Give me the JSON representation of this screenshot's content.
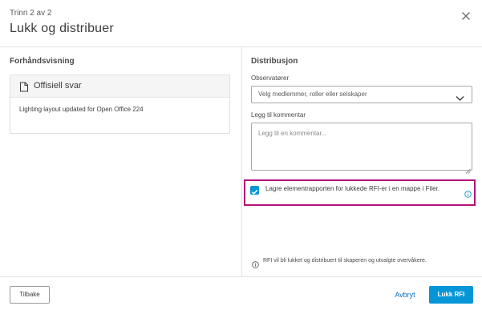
{
  "header": {
    "step": "Trinn 2 av 2",
    "title": "Lukk og distribuer",
    "close_icon": "close-icon"
  },
  "preview": {
    "section_label": "Forhåndsvisning",
    "card_icon": "document-icon",
    "card_title": "Offisiell svar",
    "card_body": "Lighting layout updated for Open Office 224"
  },
  "distribution": {
    "section_label": "Distribusjon",
    "observers_label": "Observatører",
    "observers_placeholder": "Velg medlemmer, roller eller selskaper",
    "comment_label": "Legg til kommentar",
    "comment_placeholder": "Legg til en kommentar...",
    "save_report_checked": true,
    "save_report_text": "Lagre elementrapporten for lukkede RFI-er i en mappe i Filer.",
    "note_text": "RFI vil bli lukket og distribuert til skaperen og utvalgte overvåkere."
  },
  "footer": {
    "back_label": "Tilbake",
    "cancel_label": "Avbryt",
    "primary_label": "Lukk RFI"
  },
  "colors": {
    "accent": "#0696d7",
    "highlight": "#b5127a",
    "link": "#0a6ebd"
  }
}
